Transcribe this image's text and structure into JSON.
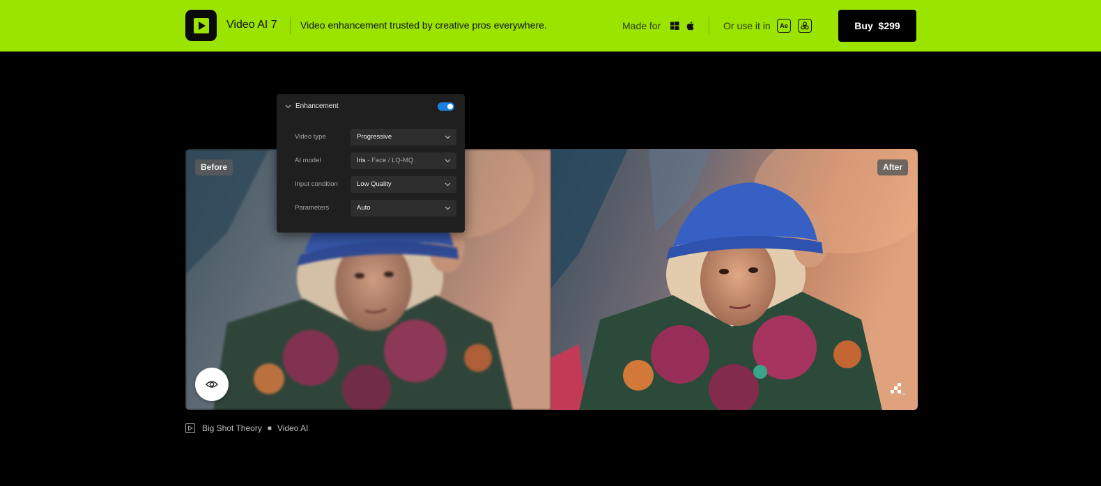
{
  "header": {
    "app_title": "Video AI 7",
    "tagline": "Video enhancement trusted by creative pros everywhere.",
    "made_for_label": "Made for",
    "os_icons": [
      "windows-icon",
      "apple-icon"
    ],
    "use_in_label": "Or use it in",
    "plugins": [
      {
        "icon": "after-effects-icon",
        "text": "Ae"
      },
      {
        "icon": "davinci-resolve-icon",
        "text": ""
      }
    ],
    "buy_label": "Buy",
    "price": "$299",
    "accent_color": "#9be400"
  },
  "compare": {
    "before_label": "Before",
    "after_label": "After"
  },
  "panel": {
    "title": "Enhancement",
    "enabled": true,
    "toggle_color": "#1a7fe0",
    "rows": [
      {
        "label": "Video type",
        "value": "Progressive",
        "sub": ""
      },
      {
        "label": "AI model",
        "value": "Iris",
        "sub": " - Face / LQ-MQ"
      },
      {
        "label": "Input condition",
        "value": "Low Quality",
        "sub": ""
      },
      {
        "label": "Parameters",
        "value": "Auto",
        "sub": ""
      }
    ]
  },
  "caption": {
    "source": "Big Shot Theory",
    "product": "Video AI"
  }
}
